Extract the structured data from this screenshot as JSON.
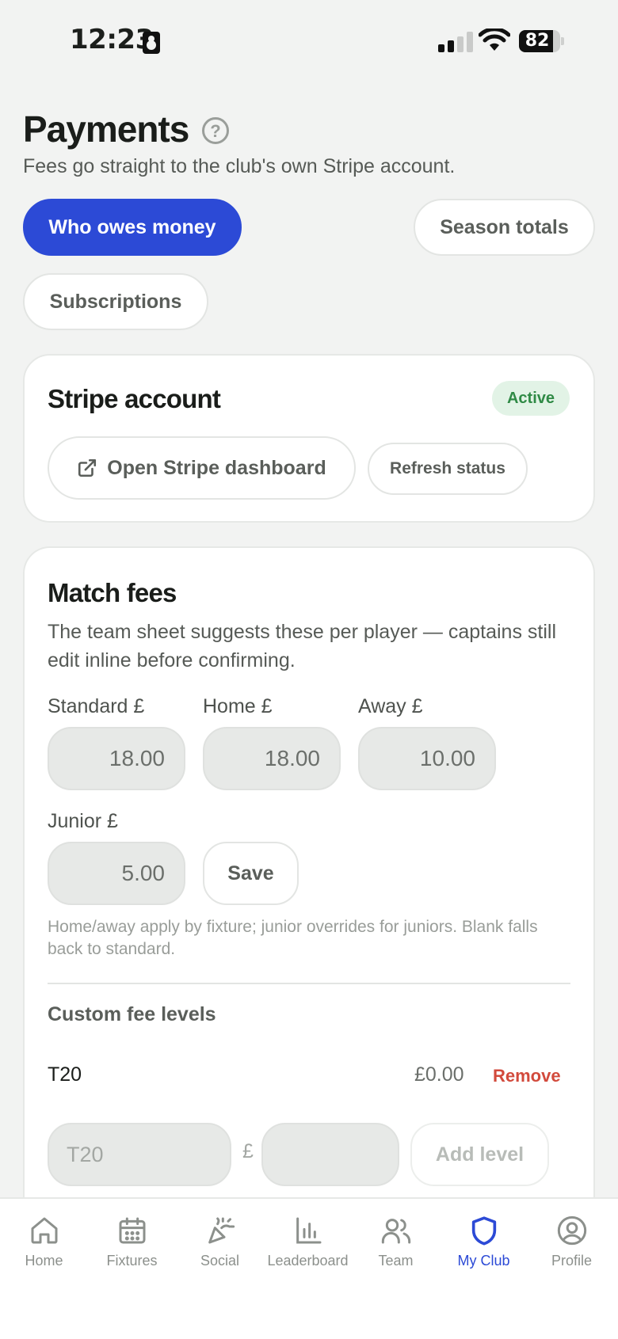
{
  "status_bar": {
    "time": "12:23",
    "battery": "82",
    "battery_level": 0.82
  },
  "header": {
    "title": "Payments",
    "subtitle": "Fees go straight to the club's own Stripe account."
  },
  "tabs": [
    {
      "label": "Who owes money",
      "active": true
    },
    {
      "label": "Season totals",
      "active": false
    },
    {
      "label": "Subscriptions",
      "active": false
    }
  ],
  "stripe_card": {
    "title": "Stripe account",
    "status": "Active",
    "dashboard_button": "Open Stripe dashboard",
    "refresh_button": "Refresh status"
  },
  "match_fees": {
    "title": "Match fees",
    "description": "The team sheet suggests these per player — captains still edit inline before confirming.",
    "standard_label": "Standard £",
    "standard_value": "18.00",
    "home_label": "Home £",
    "home_value": "18.00",
    "away_label": "Away £",
    "away_value": "10.00",
    "junior_label": "Junior £",
    "junior_value": "5.00",
    "save_button": "Save",
    "hint": "Home/away apply by fixture; junior overrides for juniors. Blank falls back to standard.",
    "custom_levels_label": "Custom fee levels",
    "custom_levels": [
      {
        "name": "T20",
        "amount": "£0.00",
        "remove_label": "Remove"
      }
    ],
    "new_level": {
      "name_placeholder": "T20",
      "currency": "£",
      "amount_placeholder": "",
      "add_button": "Add level"
    }
  },
  "bottom_nav": [
    {
      "label": "Home",
      "icon": "home-icon",
      "active": false
    },
    {
      "label": "Fixtures",
      "icon": "calendar-icon",
      "active": false
    },
    {
      "label": "Social",
      "icon": "party-popper-icon",
      "active": false
    },
    {
      "label": "Leaderboard",
      "icon": "bar-chart-icon",
      "active": false
    },
    {
      "label": "Team",
      "icon": "users-icon",
      "active": false
    },
    {
      "label": "My Club",
      "icon": "shield-icon",
      "active": true
    },
    {
      "label": "Profile",
      "icon": "user-circle-icon",
      "active": false
    }
  ],
  "colors": {
    "accent": "#2c4ad6",
    "background": "#f2f3f2",
    "active_badge_bg": "#e2f3e6",
    "active_badge_text": "#2f8a45",
    "remove_text": "#d24a3c"
  }
}
